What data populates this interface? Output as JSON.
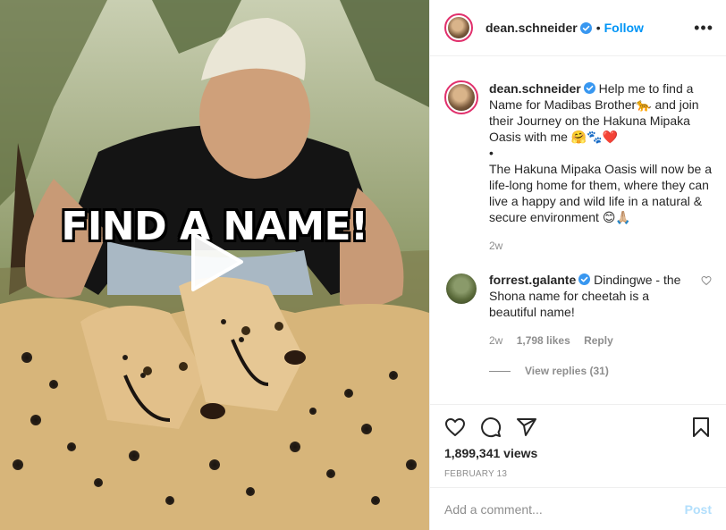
{
  "post": {
    "username": "dean.schneider",
    "follow_label": "Follow",
    "dot": "•",
    "more_label": "•••",
    "overlay_text": "FIND A NAME!",
    "caption": {
      "username": "dean.schneider",
      "text_1": "Help me to find a Name for Madibas Brother🐆 and join their Journey on the Hakuna Mipaka Oasis with me 🤗🐾❤️",
      "bullet": "•",
      "text_2": "The Hakuna Mipaka Oasis will now be a life-long home for them, where they can live a happy and wild life in a natural & secure environment 😊🙏🏼",
      "time": "2w"
    },
    "comment": {
      "username": "forrest.galante",
      "text": "Dindingwe - the Shona name for cheetah is a beautiful name!",
      "time": "2w",
      "likes": "1,798 likes",
      "reply_label": "Reply",
      "view_replies": "View replies (31)"
    },
    "views": "1,899,341 views",
    "date": "February 13",
    "add_comment_placeholder": "Add a comment...",
    "post_label": "Post"
  },
  "icons": {
    "like": "heart-icon",
    "comment": "comment-icon",
    "share": "share-icon",
    "save": "bookmark-icon",
    "play": "play-icon",
    "verified": "verified-icon"
  },
  "colors": {
    "link": "#0095f6",
    "muted": "#8e8e8e",
    "post_disabled": "#b2dffc",
    "verified": "#3897f0"
  }
}
